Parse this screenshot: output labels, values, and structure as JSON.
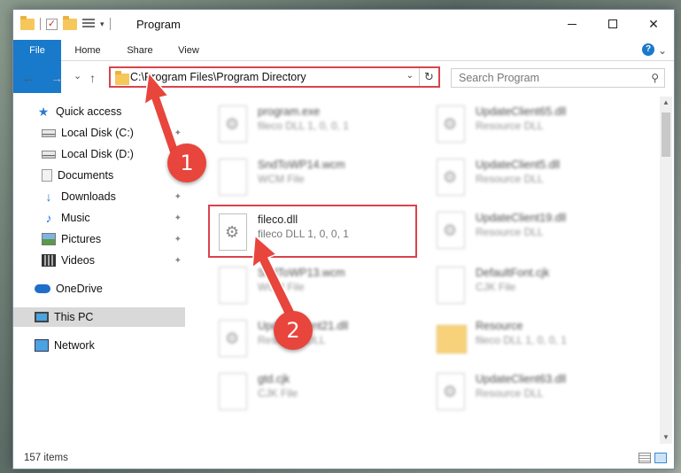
{
  "window": {
    "title": "Program",
    "min_label": "",
    "close_label": "✕"
  },
  "ribbon": {
    "tabs": [
      {
        "label": "File"
      },
      {
        "label": "Home"
      },
      {
        "label": "Share"
      },
      {
        "label": "View"
      }
    ],
    "help": "?"
  },
  "nav": {
    "back": "←",
    "forward": "→",
    "recent": "⌄",
    "up": "↑",
    "address": "C:\\Program Files\\Program Directory",
    "search_placeholder": "Search Program"
  },
  "sidebar": {
    "items": [
      {
        "label": "Quick access",
        "icon": "star-icon"
      },
      {
        "label": "Local Disk (C:)",
        "icon": "disk-icon"
      },
      {
        "label": "Local Disk (D:)",
        "icon": "disk-icon"
      },
      {
        "label": "Documents",
        "icon": "documents-icon"
      },
      {
        "label": "Downloads",
        "icon": "downloads-icon"
      },
      {
        "label": "Music",
        "icon": "music-icon"
      },
      {
        "label": "Pictures",
        "icon": "pictures-icon"
      },
      {
        "label": "Videos",
        "icon": "videos-icon"
      },
      {
        "label": "OneDrive",
        "icon": "cloud-icon"
      },
      {
        "label": "This PC",
        "icon": "pc-icon"
      },
      {
        "label": "Network",
        "icon": "network-icon"
      }
    ]
  },
  "files": {
    "left": [
      {
        "name": "program.exe",
        "desc": "fileco DLL 1, 0, 0, 1"
      },
      {
        "name": "SndToWP14.wcm",
        "desc": "WCM File"
      },
      {
        "name": "fileco.dll",
        "desc": "fileco DLL 1, 0, 0, 1"
      },
      {
        "name": "SndToWP13.wcm",
        "desc": "WCM File"
      },
      {
        "name": "UpdateClient21.dll",
        "desc": "Resource DLL"
      },
      {
        "name": "gtd.cjk",
        "desc": "CJK File"
      }
    ],
    "right": [
      {
        "name": "UpdateClient65.dll",
        "desc": "Resource DLL"
      },
      {
        "name": "UpdateClient5.dll",
        "desc": "Resource DLL"
      },
      {
        "name": "UpdateClient19.dll",
        "desc": "Resource DLL"
      },
      {
        "name": "DefaultFont.cjk",
        "desc": "CJK File"
      },
      {
        "name": "Resource",
        "desc": "fileco DLL 1, 0, 0, 1"
      },
      {
        "name": "UpdateClient63.dll",
        "desc": "Resource DLL"
      }
    ]
  },
  "status": {
    "items": "157 items"
  },
  "annotations": {
    "step1": "1",
    "step2": "2"
  },
  "colors": {
    "accent": "#1979ca",
    "highlight": "#d9434e",
    "badge": "#e8453c"
  }
}
